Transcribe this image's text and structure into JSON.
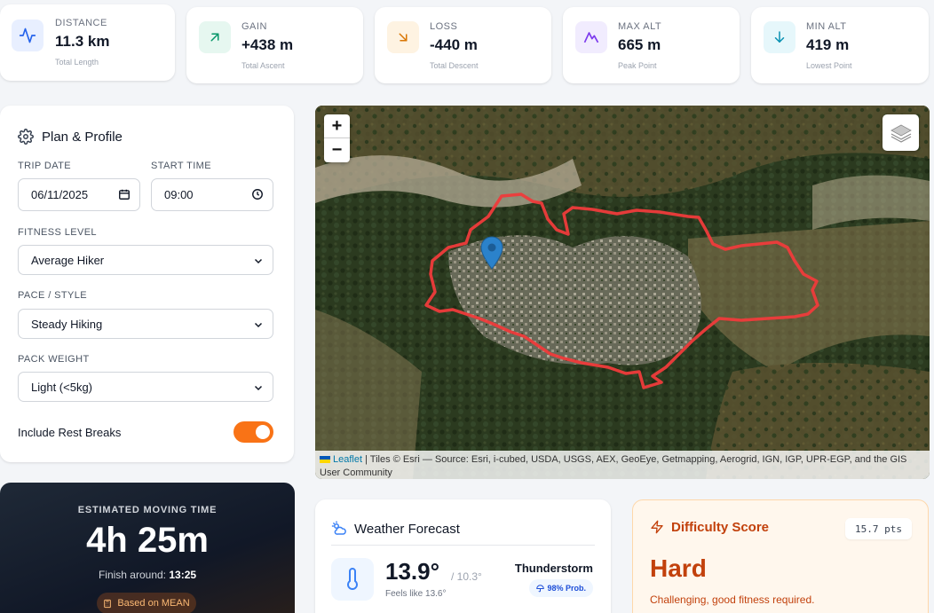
{
  "stats": [
    {
      "label": "DISTANCE",
      "value": "11.3 km",
      "sub": "Total Length",
      "icon": "activity-icon",
      "color": "#2563eb",
      "bg": "#e8efff"
    },
    {
      "label": "GAIN",
      "value": "+438 m",
      "sub": "Total Ascent",
      "icon": "trending-up-icon",
      "color": "#059669",
      "bg": "#e6f7f0"
    },
    {
      "label": "LOSS",
      "value": "-440 m",
      "sub": "Total Descent",
      "icon": "trending-down-icon",
      "color": "#d97706",
      "bg": "#fef3e2"
    },
    {
      "label": "MAX ALT",
      "value": "665 m",
      "sub": "Peak Point",
      "icon": "mountain-icon",
      "color": "#7c3aed",
      "bg": "#f1ecfe"
    },
    {
      "label": "MIN ALT",
      "value": "419 m",
      "sub": "Lowest Point",
      "icon": "arrow-down-icon",
      "color": "#0891b2",
      "bg": "#e6f7fb"
    }
  ],
  "plan": {
    "title": "Plan & Profile",
    "trip_date_label": "TRIP DATE",
    "trip_date": "06/11/2025",
    "start_time_label": "START TIME",
    "start_time": "09:00",
    "fitness_label": "FITNESS LEVEL",
    "fitness": "Average Hiker",
    "pace_label": "PACE / STYLE",
    "pace": "Steady Hiking",
    "pack_label": "PACK WEIGHT",
    "pack": "Light (<5kg)",
    "rest_label": "Include Rest Breaks",
    "rest_enabled": true
  },
  "map": {
    "zoom_in": "+",
    "zoom_out": "−",
    "attribution_link": "Leaflet",
    "attribution_text": " | Tiles © Esri — Source: Esri, i-cubed, USDA, USGS, AEX, GeoEye, Getmapping, Aerogrid, IGN, IGP, UPR-EGP, and the GIS User Community",
    "route_color": "#ef3b3b"
  },
  "moving": {
    "caption": "ESTIMATED MOVING TIME",
    "time": "4h 25m",
    "finish_label": "Finish around:",
    "finish_time": "13:25",
    "basis": "Based on MEAN"
  },
  "weather": {
    "title": "Weather Forecast",
    "temp": "13.9°",
    "temp_min": "/ 10.3°",
    "feels": "Feels like 13.6°",
    "condition": "Thunderstorm",
    "probability": "98% Prob."
  },
  "difficulty": {
    "title": "Difficulty Score",
    "points": "15.7 pts",
    "level": "Hard",
    "description": "Challenging, good fitness required."
  }
}
